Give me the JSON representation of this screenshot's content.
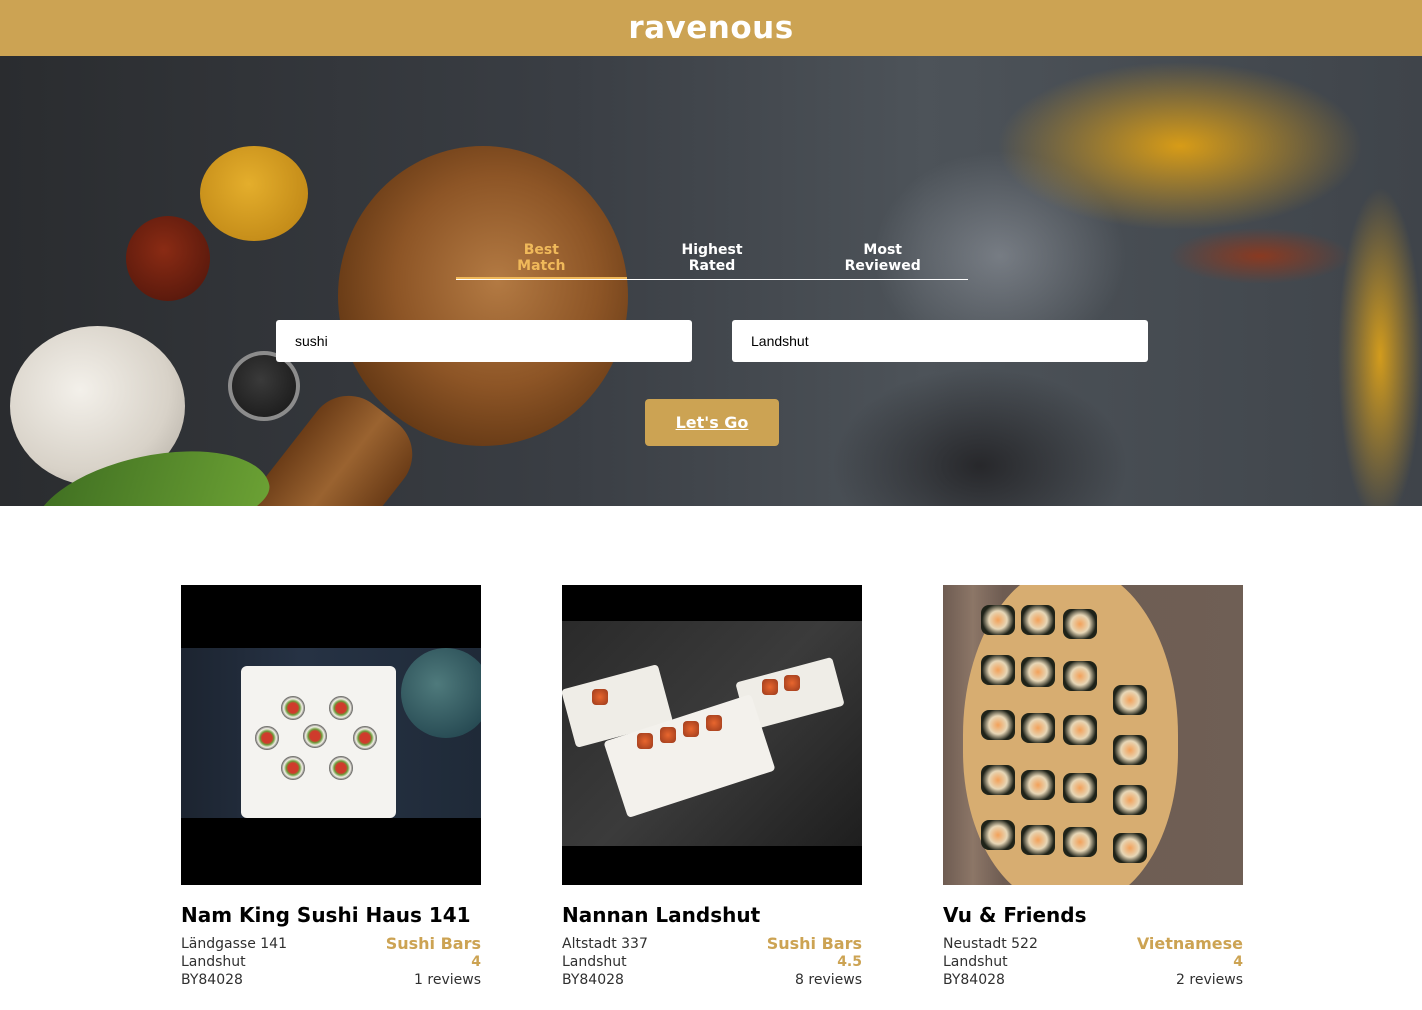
{
  "navbar": {
    "logo": "ravenous"
  },
  "sort_tabs": [
    {
      "label_line1": "Best",
      "label_line2": "Match",
      "active": true
    },
    {
      "label_line1": "Highest",
      "label_line2": "Rated",
      "active": false
    },
    {
      "label_line1": "Most",
      "label_line2": "Reviewed",
      "active": false
    }
  ],
  "search": {
    "term_value": "sushi",
    "location_value": "Landshut",
    "submit_label": "Let's Go"
  },
  "businesses": [
    {
      "name": "Nam King Sushi Haus 141",
      "address": "Ländgasse 141",
      "city": "Landshut",
      "state_zip": "BY84028",
      "category": "Sushi Bars",
      "rating": "4",
      "reviews": "1 reviews"
    },
    {
      "name": "Nannan Landshut",
      "address": "Altstadt 337",
      "city": "Landshut",
      "state_zip": "BY84028",
      "category": "Sushi Bars",
      "rating": "4.5",
      "reviews": "8 reviews"
    },
    {
      "name": "Vu & Friends",
      "address": "Neustadt 522",
      "city": "Landshut",
      "state_zip": "BY84028",
      "category": "Vietnamese",
      "rating": "4",
      "reviews": "2 reviews"
    }
  ],
  "colors": {
    "brand": "#cca353",
    "active_tab": "#f0b95a"
  }
}
